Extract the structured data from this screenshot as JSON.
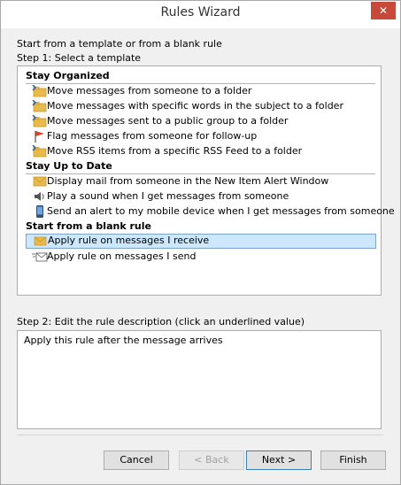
{
  "window": {
    "title": "Rules Wizard",
    "close_glyph": "✕"
  },
  "intro_label": "Start from a template or from a blank rule",
  "step1_label": "Step 1: Select a template",
  "template_groups": [
    {
      "header": "Stay Organized",
      "items": [
        {
          "label": "Move messages from someone to a folder",
          "icon": "move-folder-icon"
        },
        {
          "label": "Move messages with specific words in the subject to a folder",
          "icon": "move-folder-icon"
        },
        {
          "label": "Move messages sent to a public group to a folder",
          "icon": "move-folder-icon"
        },
        {
          "label": "Flag messages from someone for follow-up",
          "icon": "flag-icon"
        },
        {
          "label": "Move RSS items from a specific RSS Feed to a folder",
          "icon": "move-folder-icon"
        }
      ]
    },
    {
      "header": "Stay Up to Date",
      "items": [
        {
          "label": "Display mail from someone in the New Item Alert Window",
          "icon": "envelope-icon"
        },
        {
          "label": "Play a sound when I get messages from someone",
          "icon": "speaker-icon"
        },
        {
          "label": "Send an alert to my mobile device when I get messages from someone",
          "icon": "mobile-device-icon"
        }
      ]
    },
    {
      "header": "Start from a blank rule",
      "items": [
        {
          "label": "Apply rule on messages I receive",
          "icon": "receive-envelope-icon",
          "selected": true
        },
        {
          "label": "Apply rule on messages I send",
          "icon": "send-envelope-icon"
        }
      ]
    }
  ],
  "step2_label": "Step 2: Edit the rule description (click an underlined value)",
  "description_text": "Apply this rule after the message arrives",
  "buttons": {
    "cancel": "Cancel",
    "back": "< Back",
    "next": "Next >",
    "finish": "Finish"
  },
  "colors": {
    "selection_bg": "#cce8ff",
    "selection_border": "#7da2ce",
    "close_button": "#c7493a",
    "folder": "#e8b94b",
    "flag": "#d9452b",
    "arrow": "#2a63ad"
  }
}
